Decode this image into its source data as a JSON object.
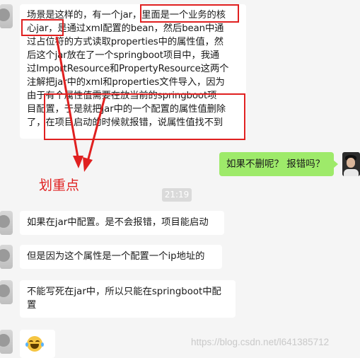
{
  "messages": {
    "main_lines": [
      "场景是这样的，有一个jar，里面是一个业务的核",
      "心jar，是通过xml配置的bean，然后bean中通",
      "过占位符的方式读取properties中的属性值，然",
      "后这个jar放在了一个springboot项目中，我通",
      "过ImportResource和PropertyResource这两个",
      "注解把jar中的xml和properties文件导入，因为",
      "由于有个属性值需要在放当前的springboot项",
      "目配置，于是就把jar中的一个配置的属性值删除",
      "了，在项目启动的时候就报错，说属性值找不到"
    ],
    "reply_green": "如果不删呢？ 报错吗？",
    "timestamp": "21:19",
    "m1": "如果在jar中配置。是不会报错，项目能启动",
    "m2": "但是因为这个属性是一个配置一个ip地址的",
    "m3_lines": [
      "不能写死在jar中，所以只能在springboot中配",
      "置"
    ],
    "m4_icon": "laughing-tears-emoji"
  },
  "annotation": {
    "label": "划重点",
    "color": "#e02020"
  },
  "watermark": "https://blog.csdn.net/l641385712",
  "colors": {
    "background": "#f5f5f5",
    "bubble": "#ffffff",
    "green_bubble": "#9eea6a",
    "timestamp_bg": "#dadada",
    "annotation_red": "#e02020"
  }
}
